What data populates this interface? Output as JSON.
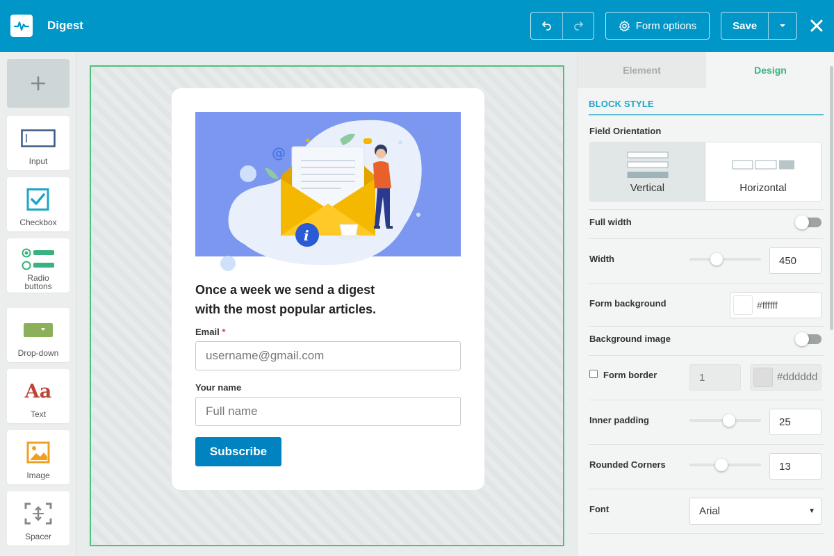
{
  "app": {
    "title": "Digest"
  },
  "toolbar": {
    "form_options_label": "Form options",
    "save_label": "Save"
  },
  "palette": {
    "items": [
      {
        "label": "Input",
        "icon": "input-icon"
      },
      {
        "label": "Checkbox",
        "icon": "checkbox-icon"
      },
      {
        "label": "Radio buttons",
        "icon": "radio-buttons-icon"
      },
      {
        "label": "Drop-down",
        "icon": "dropdown-icon"
      },
      {
        "label": "Text",
        "icon": "text-icon",
        "glyph": "Aa"
      },
      {
        "label": "Image",
        "icon": "image-icon"
      },
      {
        "label": "Spacer",
        "icon": "spacer-icon"
      }
    ]
  },
  "form": {
    "headline_line1": "Once a week we send a digest",
    "headline_line2": "with the most popular articles.",
    "email_label": "Email",
    "required_mark": "*",
    "email_placeholder": "username@gmail.com",
    "name_label": "Your name",
    "name_placeholder": "Full name",
    "submit_label": "Subscribe"
  },
  "panel": {
    "tabs": [
      {
        "label": "Element",
        "active": false
      },
      {
        "label": "Design",
        "active": true
      }
    ],
    "section_title": "BLOCK STYLE",
    "field_orientation": {
      "label": "Field Orientation",
      "options": [
        "Vertical",
        "Horizontal"
      ],
      "selected": "Vertical"
    },
    "full_width": {
      "label": "Full width",
      "enabled": false
    },
    "width": {
      "label": "Width",
      "value": "450",
      "slider_fraction": 0.35
    },
    "form_background": {
      "label": "Form background",
      "value": "#ffffff"
    },
    "background_image": {
      "label": "Background image",
      "enabled": false
    },
    "form_border": {
      "label": "Form border",
      "checked": false,
      "width": "1",
      "color": "#dddddd"
    },
    "inner_padding": {
      "label": "Inner padding",
      "value": "25",
      "slider_fraction": 0.56
    },
    "rounded_corners": {
      "label": "Rounded Corners",
      "value": "13",
      "slider_fraction": 0.44
    },
    "font": {
      "label": "Font",
      "value": "Arial"
    }
  },
  "colors": {
    "header": "#0096c7",
    "accent_green": "#36b37e",
    "section_blue": "#1aa6c9",
    "subscribe_button": "#0083c0",
    "hero_background": "#7b97ef",
    "envelope": "#f5b800"
  }
}
